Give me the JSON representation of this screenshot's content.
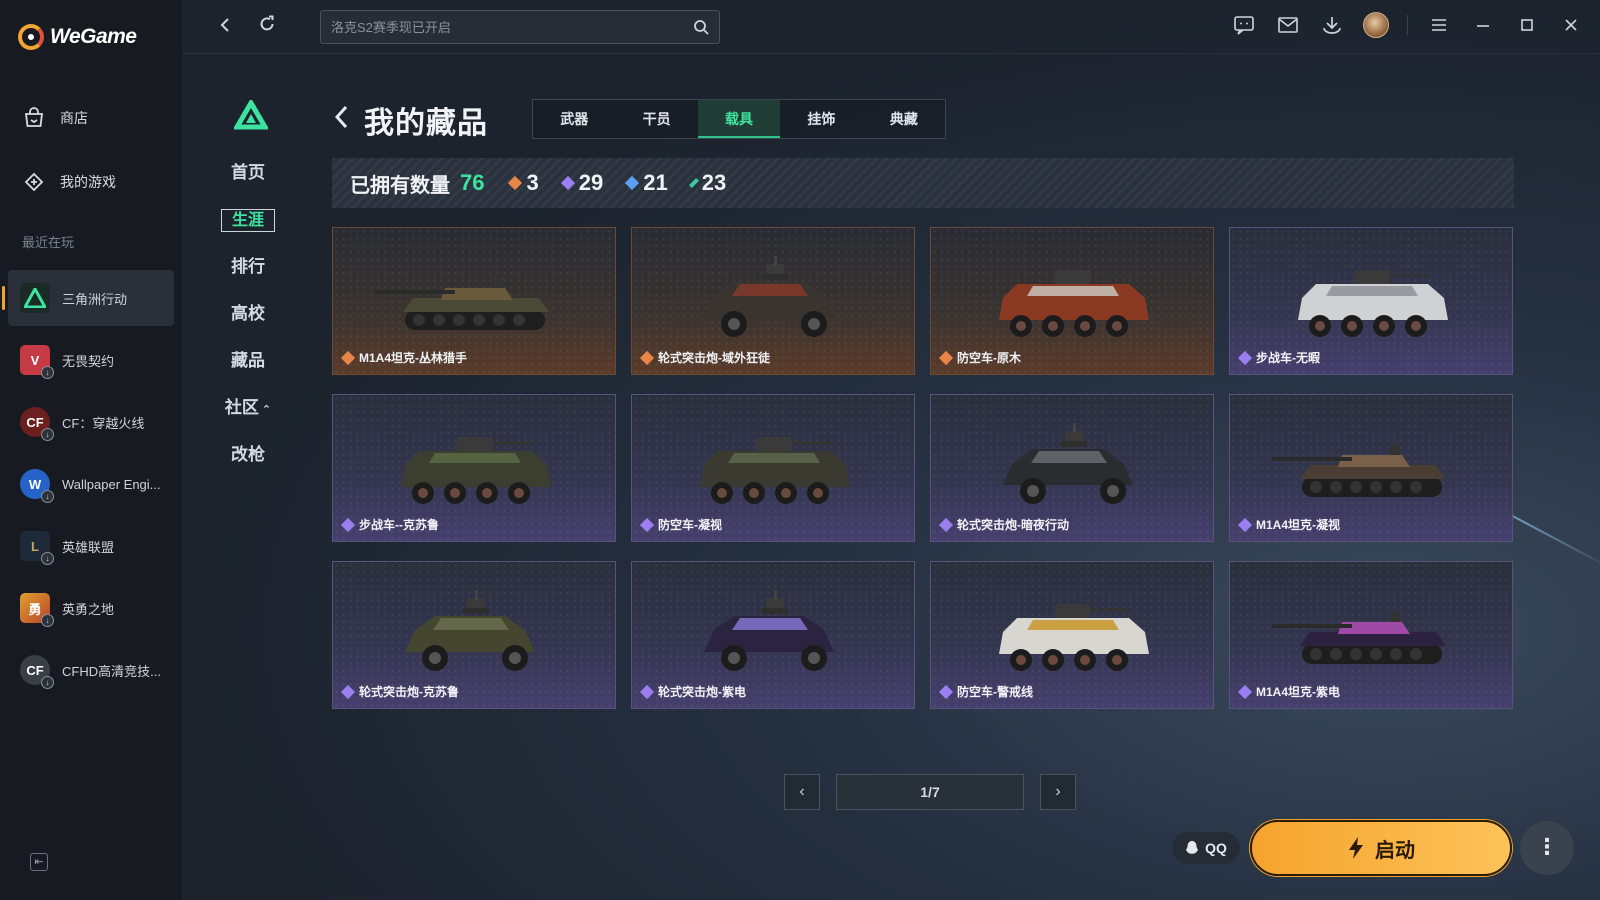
{
  "app": {
    "brand": "WeGame"
  },
  "sidebar": {
    "nav": [
      {
        "label": "商店",
        "icon": "store-icon"
      },
      {
        "label": "我的游戏",
        "icon": "gamepad-icon"
      }
    ],
    "recent_label": "最近在玩",
    "games": [
      {
        "name": "三角洲行动",
        "icon": "delta-force-icon",
        "color": "#1b2a24",
        "active": true
      },
      {
        "name": "无畏契约",
        "icon": "valorant-icon",
        "color": "#c53a45"
      },
      {
        "name": "CF：穿越火线",
        "icon": "crossfire-icon",
        "color": "#6b1f1f"
      },
      {
        "name": "Wallpaper Engi...",
        "icon": "wallpaper-engine-icon",
        "color": "#2563c9"
      },
      {
        "name": "英雄联盟",
        "icon": "lol-icon",
        "color": "#1e2a3a"
      },
      {
        "name": "英勇之地",
        "icon": "hero-land-icon",
        "color": "#b8432a"
      },
      {
        "name": "CFHD高清竞技...",
        "icon": "cfhd-icon",
        "color": "#3a3f46"
      }
    ]
  },
  "topbar": {
    "search_placeholder": "洛克S2赛季现已开启"
  },
  "subnav": {
    "items": [
      "首页",
      "生涯",
      "排行",
      "高校",
      "藏品",
      "社区",
      "改枪"
    ],
    "active_index": 1
  },
  "header": {
    "title": "我的藏品",
    "tabs": [
      "武器",
      "干员",
      "载具",
      "挂饰",
      "典藏"
    ],
    "active_tab": 2
  },
  "stats": {
    "label": "已拥有数量",
    "total": "76",
    "items": [
      {
        "value": "3",
        "color": "#e8864a"
      },
      {
        "value": "29",
        "color": "#9b7ff0"
      },
      {
        "value": "21",
        "color": "#5aa0f0"
      },
      {
        "value": "23",
        "color": "#3fc8a0"
      }
    ]
  },
  "cards": [
    {
      "name": "M1A4坦克-丛林猎手",
      "rarity": "orange",
      "kind": "tank",
      "body": "#4b4a36",
      "accent": "#6a5a3c"
    },
    {
      "name": "轮式突击炮-域外狂徒",
      "rarity": "orange",
      "kind": "armored-car",
      "body": "#3a3430",
      "accent": "#8a3a2c"
    },
    {
      "name": "防空车-原木",
      "rarity": "orange",
      "kind": "apc",
      "body": "#8a3a22",
      "accent": "#c8c4bc"
    },
    {
      "name": "步战车-无暇",
      "rarity": "purple",
      "kind": "apc",
      "body": "#cfd1d4",
      "accent": "#8e9298"
    },
    {
      "name": "步战车--克苏鲁",
      "rarity": "purple",
      "kind": "apc",
      "body": "#3c3e30",
      "accent": "#5a6a44"
    },
    {
      "name": "防空车-凝视",
      "rarity": "purple",
      "kind": "apc",
      "body": "#3a3a30",
      "accent": "#5e6a4c"
    },
    {
      "name": "轮式突击炮-暗夜行动",
      "rarity": "purple",
      "kind": "armored-car",
      "body": "#2a2c30",
      "accent": "#6c7076"
    },
    {
      "name": "M1A4坦克-凝视",
      "rarity": "purple",
      "kind": "tank",
      "body": "#4a3e34",
      "accent": "#7a6048"
    },
    {
      "name": "轮式突击炮-克苏鲁",
      "rarity": "purple",
      "kind": "armored-car",
      "body": "#444630",
      "accent": "#6a7050"
    },
    {
      "name": "轮式突击炮-紫电",
      "rarity": "purple",
      "kind": "armored-car",
      "body": "#2a2440",
      "accent": "#8a7ad8"
    },
    {
      "name": "防空车-警戒线",
      "rarity": "purple",
      "kind": "apc",
      "body": "#d8d6d0",
      "accent": "#c8962a"
    },
    {
      "name": "M1A4坦克-紫电",
      "rarity": "purple",
      "kind": "tank",
      "body": "#2c2240",
      "accent": "#a04aa8"
    }
  ],
  "rarity_colors": {
    "orange": "#e8864a",
    "purple": "#9b7ff0"
  },
  "pager": {
    "text": "1/7",
    "prev": "‹",
    "next": "›"
  },
  "bottom": {
    "qq_label": "QQ",
    "launch_label": "启动",
    "more_label": "⋮"
  }
}
